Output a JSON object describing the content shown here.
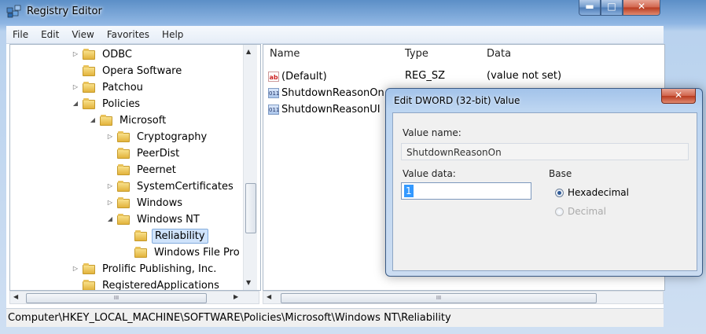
{
  "window": {
    "title": "Registry Editor",
    "buttons": {
      "minimize": "▬",
      "maximize": "□",
      "close": "✕"
    }
  },
  "menu": [
    "File",
    "Edit",
    "View",
    "Favorites",
    "Help"
  ],
  "tree": {
    "items": [
      {
        "label": "ODBC",
        "expander": "▷"
      },
      {
        "label": "Opera Software",
        "expander": ""
      },
      {
        "label": "Patchou",
        "expander": "▷"
      },
      {
        "label": "Policies",
        "expander": "◢"
      },
      {
        "label": "Microsoft",
        "expander": "◢"
      },
      {
        "label": "Cryptography",
        "expander": "▷"
      },
      {
        "label": "PeerDist",
        "expander": ""
      },
      {
        "label": "Peernet",
        "expander": ""
      },
      {
        "label": "SystemCertificates",
        "expander": "▷"
      },
      {
        "label": "Windows",
        "expander": "▷"
      },
      {
        "label": "Windows NT",
        "expander": "◢"
      },
      {
        "label": "Reliability",
        "expander": ""
      },
      {
        "label": "Windows File Pro",
        "expander": ""
      },
      {
        "label": "Prolific Publishing, Inc.",
        "expander": "▷"
      },
      {
        "label": "RegisteredApplications",
        "expander": ""
      }
    ],
    "selected": "Reliability"
  },
  "list": {
    "columns": [
      "Name",
      "Type",
      "Data"
    ],
    "rows": [
      {
        "icon": "ab",
        "name": "(Default)",
        "type": "REG_SZ",
        "data": "(value not set)"
      },
      {
        "icon": "011",
        "name": "ShutdownReasonOn",
        "type": "",
        "data": ""
      },
      {
        "icon": "011",
        "name": "ShutdownReasonUI",
        "type": "",
        "data": ""
      }
    ]
  },
  "status": "Computer\\HKEY_LOCAL_MACHINE\\SOFTWARE\\Policies\\Microsoft\\Windows NT\\Reliability",
  "dialog": {
    "title": "Edit DWORD (32-bit) Value",
    "close": "✕",
    "value_name_label": "Value name:",
    "value_name": "ShutdownReasonOn",
    "value_data_label": "Value data:",
    "value_data": "1",
    "base_label": "Base",
    "base_options": [
      "Hexadecimal",
      "Decimal"
    ],
    "base_selected": "Hexadecimal"
  },
  "scroll_grip": "III"
}
